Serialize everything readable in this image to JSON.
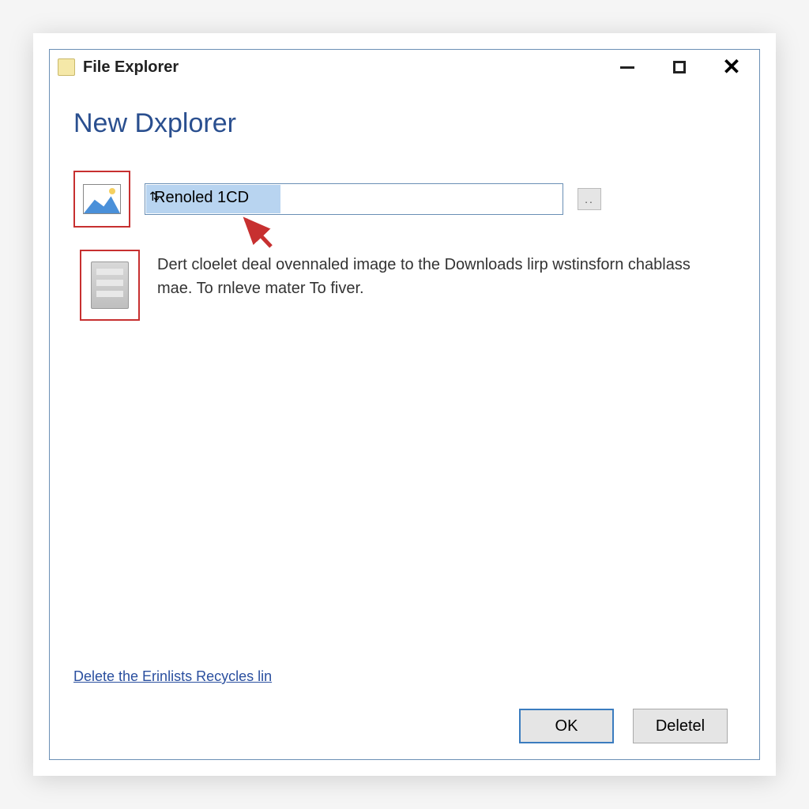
{
  "titlebar": {
    "title": "File Explorer"
  },
  "content": {
    "heading": "New Dxplorer",
    "input_value": "Renoled 1CD",
    "browse_label": "..",
    "description": "Dert cloelet deal ovennaled image to the Downloads lirp wstinsforn chablass mae. To rnleve mater To fiver.",
    "link_text": "Delete the Erinlists Recycles lin"
  },
  "footer": {
    "ok_label": "OK",
    "delete_label": "Deletel"
  },
  "annotations": {
    "highlight_color": "#c73030",
    "arrow_color": "#c73030"
  }
}
